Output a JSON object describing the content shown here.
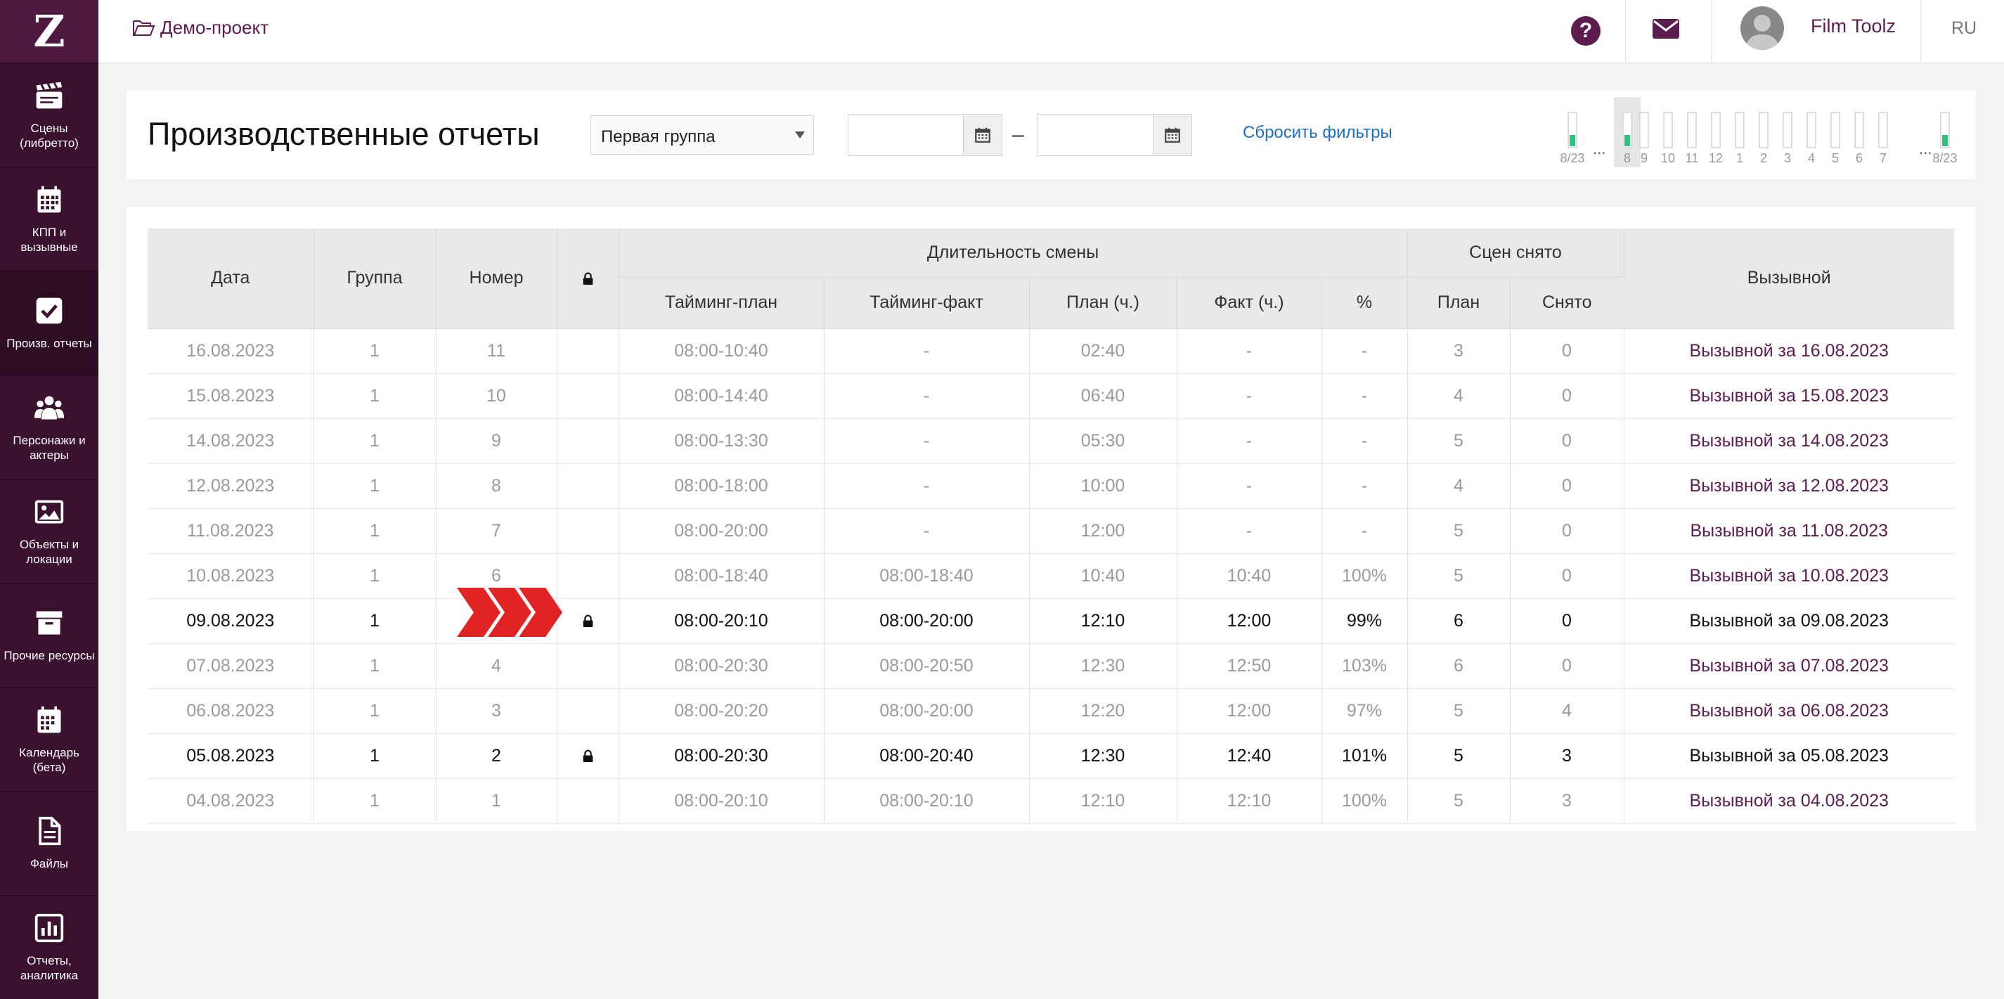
{
  "sidebar": {
    "logo": "Z",
    "items": [
      {
        "label": "Сцены (либретто)",
        "icon": "clapperboard-icon"
      },
      {
        "label": "КПП и вызывные",
        "icon": "calendar-grid-icon"
      },
      {
        "label": "Произв. отчеты",
        "icon": "checkbox-icon"
      },
      {
        "label": "Персонажи и актеры",
        "icon": "people-icon"
      },
      {
        "label": "Объекты и локации",
        "icon": "image-icon"
      },
      {
        "label": "Прочие ресурсы",
        "icon": "archive-box-icon"
      },
      {
        "label": "Календарь (бета)",
        "icon": "calendar-icon"
      },
      {
        "label": "Файлы",
        "icon": "file-icon"
      },
      {
        "label": "Отчеты, аналитика",
        "icon": "bar-chart-icon"
      }
    ]
  },
  "topbar": {
    "project": "Демо-проект",
    "user": "Film Toolz",
    "lang": "RU",
    "help_glyph": "?"
  },
  "filters": {
    "title": "Производственные отчеты",
    "group_selected": "Первая группа",
    "date_from": "",
    "date_to": "",
    "date_separator": "–",
    "reset": "Сбросить фильтры"
  },
  "timeline": {
    "labels": [
      "8/23",
      "8",
      "9",
      "10",
      "11",
      "12",
      "1",
      "2",
      "3",
      "4",
      "5",
      "6",
      "7",
      "8/23"
    ],
    "filled": [
      true,
      true,
      false,
      false,
      false,
      false,
      false,
      false,
      false,
      false,
      false,
      false,
      false,
      true
    ],
    "ellipsis": "..."
  },
  "table": {
    "headers": {
      "date": "Дата",
      "group": "Группа",
      "number": "Номер",
      "duration_group": "Длительность смены",
      "timing_plan": "Тайминг-план",
      "timing_fact": "Тайминг-факт",
      "plan_h": "План (ч.)",
      "fact_h": "Факт (ч.)",
      "percent": "%",
      "scenes_group": "Сцен снято",
      "scenes_plan": "План",
      "scenes_done": "Снято",
      "callsheet": "Вызывной"
    },
    "rows": [
      {
        "date": "16.08.2023",
        "group": "1",
        "number": "11",
        "locked": false,
        "tplan": "08:00-10:40",
        "tfact": "-",
        "planh": "02:40",
        "facth": "-",
        "pct": "-",
        "splan": "3",
        "sdone": "0",
        "call": "Вызывной за 16.08.2023"
      },
      {
        "date": "15.08.2023",
        "group": "1",
        "number": "10",
        "locked": false,
        "tplan": "08:00-14:40",
        "tfact": "-",
        "planh": "06:40",
        "facth": "-",
        "pct": "-",
        "splan": "4",
        "sdone": "0",
        "call": "Вызывной за 15.08.2023"
      },
      {
        "date": "14.08.2023",
        "group": "1",
        "number": "9",
        "locked": false,
        "tplan": "08:00-13:30",
        "tfact": "-",
        "planh": "05:30",
        "facth": "-",
        "pct": "-",
        "splan": "5",
        "sdone": "0",
        "call": "Вызывной за 14.08.2023"
      },
      {
        "date": "12.08.2023",
        "group": "1",
        "number": "8",
        "locked": false,
        "tplan": "08:00-18:00",
        "tfact": "-",
        "planh": "10:00",
        "facth": "-",
        "pct": "-",
        "splan": "4",
        "sdone": "0",
        "call": "Вызывной за 12.08.2023"
      },
      {
        "date": "11.08.2023",
        "group": "1",
        "number": "7",
        "locked": false,
        "tplan": "08:00-20:00",
        "tfact": "-",
        "planh": "12:00",
        "facth": "-",
        "pct": "-",
        "splan": "5",
        "sdone": "0",
        "call": "Вызывной за 11.08.2023"
      },
      {
        "date": "10.08.2023",
        "group": "1",
        "number": "6",
        "locked": false,
        "tplan": "08:00-18:40",
        "tfact": "08:00-18:40",
        "planh": "10:40",
        "facth": "10:40",
        "pct": "100%",
        "splan": "5",
        "sdone": "0",
        "call": "Вызывной за 10.08.2023"
      },
      {
        "date": "09.08.2023",
        "group": "1",
        "number": "",
        "locked": true,
        "tplan": "08:00-20:10",
        "tfact": "08:00-20:00",
        "planh": "12:10",
        "facth": "12:00",
        "pct": "99%",
        "splan": "6",
        "sdone": "0",
        "call": "Вызывной за 09.08.2023"
      },
      {
        "date": "07.08.2023",
        "group": "1",
        "number": "4",
        "locked": false,
        "tplan": "08:00-20:30",
        "tfact": "08:00-20:50",
        "planh": "12:30",
        "facth": "12:50",
        "pct": "103%",
        "splan": "6",
        "sdone": "0",
        "call": "Вызывной за 07.08.2023"
      },
      {
        "date": "06.08.2023",
        "group": "1",
        "number": "3",
        "locked": false,
        "tplan": "08:00-20:20",
        "tfact": "08:00-20:00",
        "planh": "12:20",
        "facth": "12:00",
        "pct": "97%",
        "splan": "5",
        "sdone": "4",
        "call": "Вызывной за 06.08.2023"
      },
      {
        "date": "05.08.2023",
        "group": "1",
        "number": "2",
        "locked": true,
        "tplan": "08:00-20:30",
        "tfact": "08:00-20:40",
        "planh": "12:30",
        "facth": "12:40",
        "pct": "101%",
        "splan": "5",
        "sdone": "3",
        "call": "Вызывной за 05.08.2023"
      },
      {
        "date": "04.08.2023",
        "group": "1",
        "number": "1",
        "locked": false,
        "tplan": "08:00-20:10",
        "tfact": "08:00-20:10",
        "planh": "12:10",
        "facth": "12:10",
        "pct": "100%",
        "splan": "5",
        "sdone": "3",
        "call": "Вызывной за 04.08.2023"
      }
    ]
  },
  "colors": {
    "sidebar": "#3a1230",
    "accent": "#5c1c4f",
    "link": "#1f6fc9",
    "progress": "#2ec27e",
    "highlight_arrow": "#e02424"
  }
}
